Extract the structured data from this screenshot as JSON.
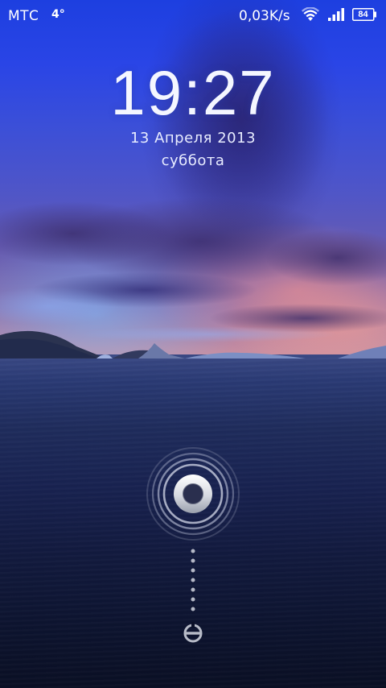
{
  "status_bar": {
    "carrier": "МТС",
    "temperature": "4°",
    "network_speed": "0,03K/s",
    "wifi_icon": "wifi-icon",
    "signal_icon": "cell-signal-icon",
    "battery_level": "84"
  },
  "lock_screen": {
    "time": "19:27",
    "date": "13 Апреля 2013",
    "weekday": "суббота",
    "unlock_handle_icon": "ring-unlock-handle-icon",
    "unlock_target_icon": "unlock-target-icon"
  },
  "colors": {
    "sky_top": "#1d3fe0",
    "horizon": "#cf92a0",
    "sea_bottom": "#0a0f24",
    "text": "#ffffff"
  }
}
